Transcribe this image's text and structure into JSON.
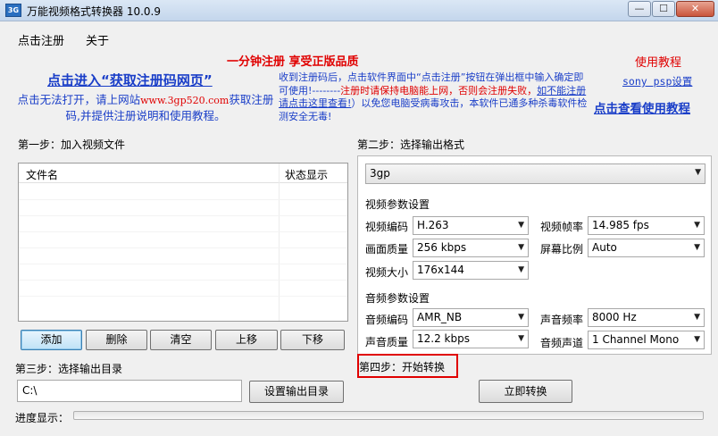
{
  "window": {
    "title": "万能视频格式转换器 10.0.9",
    "icon_text": "3G",
    "minimize_glyph": "—",
    "maximize_glyph": "☐",
    "close_glyph": "✕"
  },
  "menu": {
    "register": "点击注册",
    "about": "关于"
  },
  "promo": {
    "red_headline": "一分钟注册  享受正版品质",
    "reg_page_link": "点击进入“获取注册码网页”",
    "left_text_1": "点击无法打开，请上网站",
    "left_site": "www.3gp520.com",
    "left_text_2": "获取注册码,并提供注册说明和使用教程。",
    "mid_text_1": "收到注册码后，点击软件界面中“点击注册”按钮在弹出框中输入确定即可使用!--------",
    "mid_red": "注册时请保持电脑能上网，否则会注册失败，",
    "mid_underline": "如不能注册请点击这里查看!",
    "mid_text_2": "）以免您电脑受病毒攻击，本软件已通多种杀毒软件检测安全无毒!",
    "tutorial_title": "使用教程",
    "psp_link": "sony psp设置",
    "tutorial_link": "点击查看使用教程"
  },
  "step1": {
    "label": "第一步：加入视频文件",
    "columns": [
      "文件名",
      "状态显示"
    ],
    "rows": [],
    "buttons": {
      "add": "添加",
      "delete": "删除",
      "clear": "清空",
      "up": "上移",
      "down": "下移"
    }
  },
  "step2": {
    "label": "第二步：选择输出格式",
    "format": "3gp",
    "video_section": "视频参数设置",
    "audio_section": "音频参数设置",
    "video": {
      "codec_label": "视频编码",
      "codec": "H.263",
      "fps_label": "视频帧率",
      "fps": "14.985 fps",
      "quality_label": "画面质量",
      "quality": "256 kbps",
      "ratio_label": "屏幕比例",
      "ratio": "Auto",
      "size_label": "视频大小",
      "size": "176x144"
    },
    "audio": {
      "codec_label": "音频编码",
      "codec": "AMR_NB",
      "rate_label": "声音频率",
      "rate": "8000 Hz",
      "quality_label": "声音质量",
      "quality": "12.2 kbps",
      "channel_label": "音频声道",
      "channel": "1 Channel Mono"
    },
    "dropdown_arrow": "▼"
  },
  "step3": {
    "label": "第三步：选择输出目录",
    "dir": "C:\\",
    "set_dir_button": "设置输出目录"
  },
  "step4": {
    "label": "第四步：开始转换",
    "convert_button": "立即转换"
  },
  "progress": {
    "label": "进度显示：",
    "percent": 0
  }
}
